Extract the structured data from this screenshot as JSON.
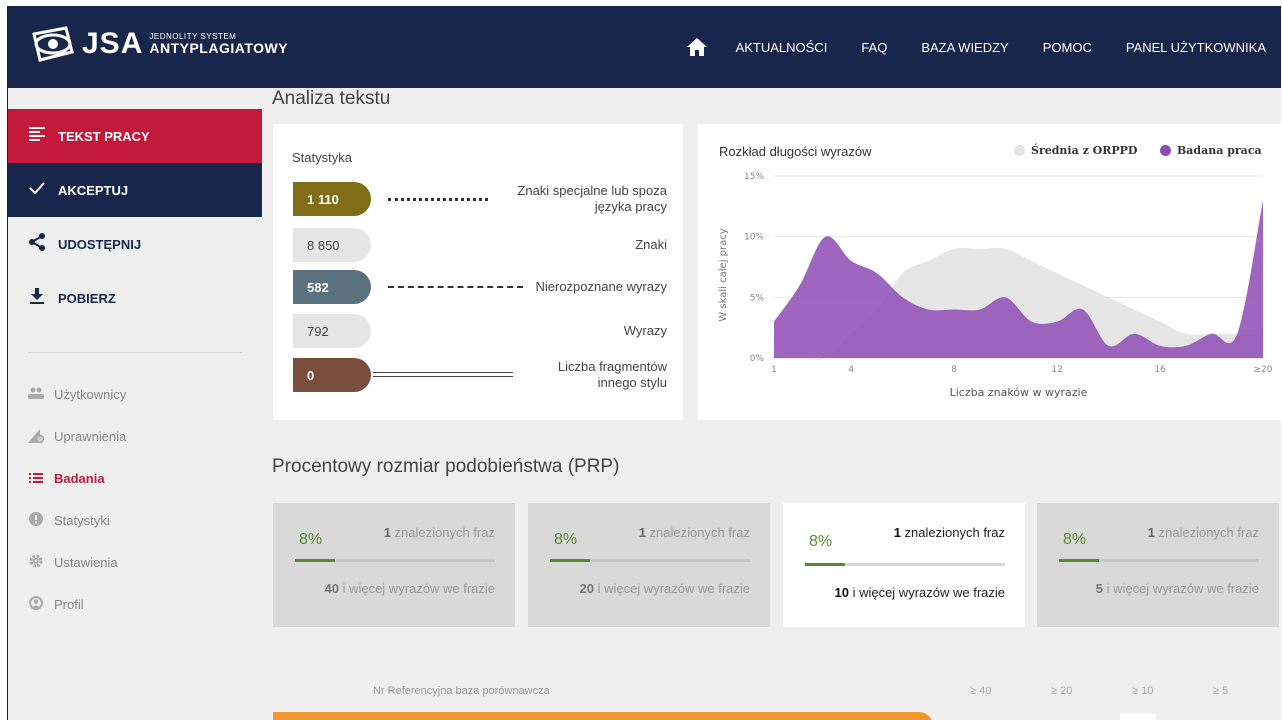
{
  "header": {
    "logo_main": "JSA",
    "logo_top": "JEDNOLITY SYSTEM",
    "logo_bottom": "ANTYPLAGIATOWY",
    "nav": [
      "AKTUALNOŚCI",
      "FAQ",
      "BAZA WIEDZY",
      "POMOC",
      "PANEL UŻYTKOWNIKA"
    ],
    "home_icon": "home-icon"
  },
  "sidebar": {
    "main": [
      {
        "label": "TEKST PRACY",
        "icon": "text-lines-icon"
      },
      {
        "label": "AKCEPTUJ",
        "icon": "check-icon"
      },
      {
        "label": "UDOSTĘPNIJ",
        "icon": "share-icon"
      },
      {
        "label": "POBIERZ",
        "icon": "download-icon"
      }
    ],
    "sub": [
      {
        "label": "Użytkownicy",
        "icon": "users-icon"
      },
      {
        "label": "Uprawnienia",
        "icon": "permissions-icon"
      },
      {
        "label": "Badania",
        "icon": "list-icon"
      },
      {
        "label": "Statystyki",
        "icon": "info-icon"
      },
      {
        "label": "Ustawienia",
        "icon": "gear-icon"
      },
      {
        "label": "Profil",
        "icon": "profile-icon"
      }
    ]
  },
  "main": {
    "title": "Analiza tekstu",
    "stats": {
      "title": "Statystyka",
      "rows": [
        {
          "value": "1 110",
          "label": "Znaki specjalne lub spoza języka pracy"
        },
        {
          "value": "8 850",
          "label": "Znaki"
        },
        {
          "value": "582",
          "label": "Nierozpoznane wyrazy"
        },
        {
          "value": "792",
          "label": "Wyrazy"
        },
        {
          "value": "0",
          "label": "Liczba fragmentów innego stylu"
        }
      ]
    },
    "prp_title": "Procentowy rozmiar podobieństwa (PRP)",
    "prp_cards": [
      {
        "pct": "8%",
        "count": "1",
        "count_text": " znalezionych fraz",
        "words": "40",
        "words_text": " i więcej wyrazów we frazie",
        "fill": 0.08
      },
      {
        "pct": "8%",
        "count": "1",
        "count_text": " znalezionych fraz",
        "words": "20",
        "words_text": " i więcej wyrazów we frazie",
        "fill": 0.08
      },
      {
        "pct": "8%",
        "count": "1",
        "count_text": " znalezionych fraz",
        "words": "10",
        "words_text": " i więcej wyrazów we frazie",
        "fill": 0.08
      },
      {
        "pct": "8%",
        "count": "1",
        "count_text": " znalezionych fraz",
        "words": "5",
        "words_text": " i więcej wyrazów we frazie",
        "fill": 0.08
      }
    ],
    "table_header": {
      "ref": "Nr Referencyjna baza porównawcza",
      "cols": [
        "≥ 40",
        "≥ 20",
        "≥ 10",
        "≥ 5"
      ]
    }
  },
  "colors": {
    "header_bg": "#17264a",
    "active_red": "#c31a3b",
    "series_avg": "#e3e3e3",
    "series_work": "#8e4bb5",
    "pct_green": "#5a8a2e",
    "orange_bar": "#f0962e"
  },
  "chart_data": {
    "type": "area",
    "title": "Rozkład długości wyrazów",
    "xlabel": "Liczba znaków w wyrazie",
    "ylabel": "W skali całej pracy",
    "x": [
      1,
      2,
      3,
      4,
      5,
      6,
      7,
      8,
      9,
      10,
      11,
      12,
      13,
      14,
      15,
      16,
      17,
      18,
      19,
      20
    ],
    "xticks": [
      "1",
      "4",
      "8",
      "12",
      "16",
      "≥20"
    ],
    "xtick_values": [
      1,
      4,
      8,
      12,
      16,
      20
    ],
    "yticks": [
      "0%",
      "5%",
      "10%",
      "15%"
    ],
    "ytick_values": [
      0,
      5,
      10,
      15
    ],
    "ylim": [
      0,
      15
    ],
    "legend_position": "top-right",
    "series": [
      {
        "name": "Średnia z ORPPD",
        "color": "#e3e3e3",
        "values": [
          0,
          0,
          0,
          2,
          4,
          7,
          8,
          9,
          9,
          9,
          8,
          7,
          6,
          5,
          4,
          3,
          2,
          2,
          2,
          2
        ]
      },
      {
        "name": "Badana praca",
        "color": "#8e4bb5",
        "values": [
          3,
          6,
          10,
          8,
          7,
          5,
          4,
          4,
          4,
          5,
          3,
          3,
          4,
          1,
          2,
          1,
          1,
          2,
          2,
          13
        ]
      }
    ]
  }
}
